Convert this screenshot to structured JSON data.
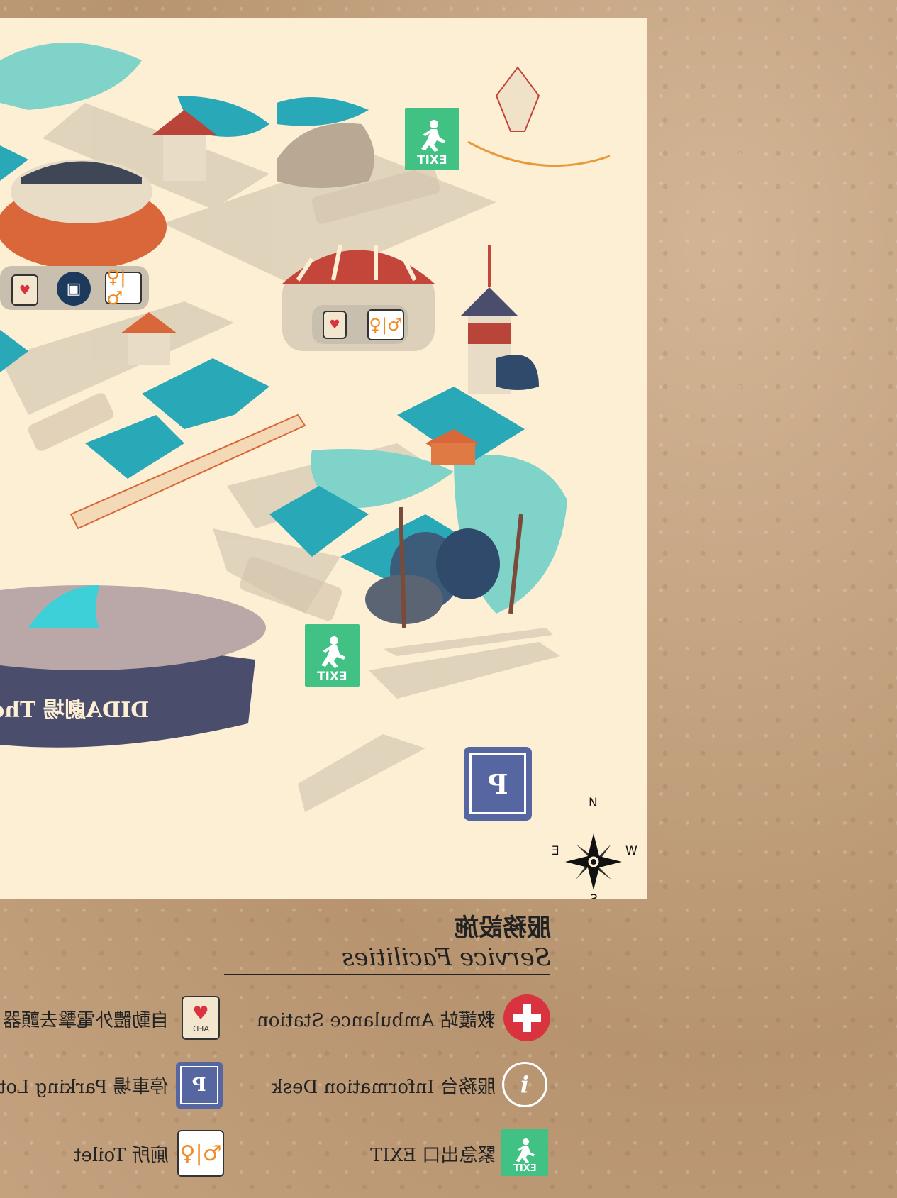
{
  "map": {
    "theatre_label": "DIDA劇場 Theatre",
    "compass": {
      "north": "N",
      "south": "S",
      "east": "E",
      "west": "W"
    },
    "markers": {
      "exit_text": "EXIT",
      "parking_text": "P",
      "aed_text": "AED"
    },
    "icons": [
      "exit-icon",
      "parking-icon",
      "aed-icon",
      "toilet-icon",
      "shopping-bag-icon",
      "compass-rose-icon",
      "wave-icon"
    ]
  },
  "legend": {
    "title_zh": "服務設施",
    "title_en": "Service Facilities",
    "items": [
      {
        "label": "救護站 Ambulance Station",
        "icon": "first-aid-cross-icon",
        "color": "#d8333e"
      },
      {
        "label": "自動體外電擊去顫器",
        "icon": "aed-icon",
        "color": "#f3e6cf"
      },
      {
        "label": "服務台 Information Desk",
        "icon": "info-icon",
        "color": "#ffffff"
      },
      {
        "label": "停車場 Parking Lot",
        "icon": "parking-icon",
        "color": "#5566a0"
      },
      {
        "label": "緊急出口 EXIT",
        "icon": "exit-icon",
        "color": "#41c184"
      },
      {
        "label": "廁所 Toilet",
        "icon": "toilet-icon",
        "color": "#f08a24"
      }
    ],
    "icon_texts": {
      "parking": "P",
      "info": "i",
      "exit": "EXIT",
      "aed": "AED"
    }
  },
  "colors": {
    "map_bg": "#fdefd4",
    "paper": "#c9a986",
    "teal": "#29a9b8",
    "orange": "#d9673a",
    "navy": "#4a4d6b",
    "exit_green": "#41c184",
    "parking_blue": "#5566a0"
  }
}
